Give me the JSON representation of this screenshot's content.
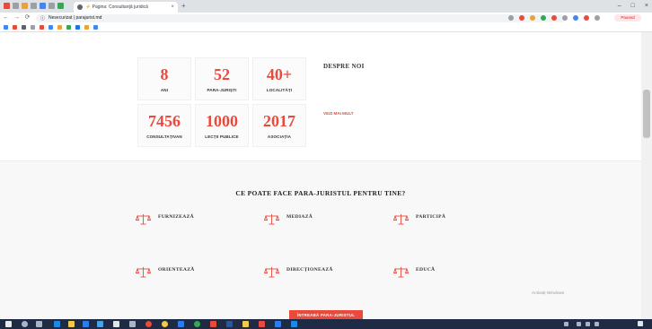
{
  "browser": {
    "tab_title": "⚡ Pagina: Consultanţă juridică",
    "tab_close": "×",
    "new_tab": "+",
    "window_controls": [
      "–",
      "□",
      "×"
    ],
    "nav": {
      "back": "←",
      "forward": "→",
      "reload": "⟳"
    },
    "info_icon": "ⓘ",
    "address": "Nesecurizat | parajurist.md",
    "profile_button": "Paused"
  },
  "stats": [
    {
      "value": "8",
      "label": "ANI"
    },
    {
      "value": "52",
      "label": "PARA-JURIȘTI"
    },
    {
      "value": "40+",
      "label": "LOCALITĂȚI"
    },
    {
      "value": "7456",
      "label": "CONSULTAȚIVAN"
    },
    {
      "value": "1000",
      "label": "LECȚII PUBLICE"
    },
    {
      "value": "2017",
      "label": "ASOCIAȚIA"
    }
  ],
  "about": {
    "title": "DESPRE NOI",
    "text": "",
    "link": "VEZI MAI MULT"
  },
  "services_section": {
    "title": "CE POATE FACE PARA-JURISTUL PENTRU TINE?",
    "items": [
      {
        "title": "FURNIZEAZĂ",
        "desc": ""
      },
      {
        "title": "MEDIAZĂ",
        "desc": ""
      },
      {
        "title": "PARTICIPĂ",
        "desc": ""
      },
      {
        "title": "ORIENTEAZĂ",
        "desc": ""
      },
      {
        "title": "DIRECȚIONEAZĂ",
        "desc": ""
      },
      {
        "title": "EDUCĂ",
        "desc": ""
      }
    ],
    "cta": "ÎNTREABĂ PARA-JURISTUL"
  },
  "watermark": {
    "line1": "Activați Windows"
  },
  "colors": {
    "accent": "#e84a3c",
    "section_bg": "#f8f8f8",
    "taskbar": "#1f2a44"
  },
  "icons": {
    "service": "scales-of-justice-icon"
  }
}
